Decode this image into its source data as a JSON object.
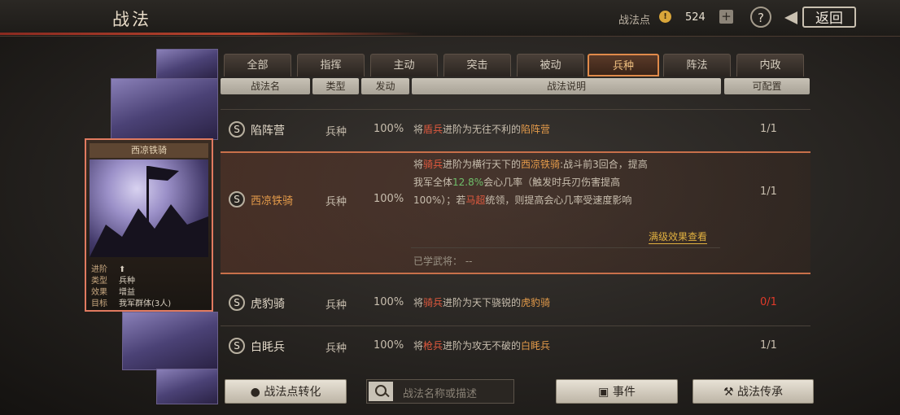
{
  "header": {
    "title": "战法",
    "points_label": "战法点",
    "points_icon_glyph": "!",
    "points_value": "524",
    "add_glyph": "+",
    "help_glyph": "?",
    "back_label": "返回"
  },
  "selected_card": {
    "name": "西凉铁骑",
    "rows": [
      {
        "k": "进阶",
        "v": "⬆"
      },
      {
        "k": "类型",
        "v": "兵种"
      },
      {
        "k": "效果",
        "v": "增益"
      },
      {
        "k": "目标",
        "v": "我军群体(3人)"
      }
    ]
  },
  "tabs": [
    {
      "label": "全部",
      "active": false
    },
    {
      "label": "指挥",
      "active": false
    },
    {
      "label": "主动",
      "active": false
    },
    {
      "label": "突击",
      "active": false
    },
    {
      "label": "被动",
      "active": false
    },
    {
      "label": "兵种",
      "active": true
    },
    {
      "label": "阵法",
      "active": false
    },
    {
      "label": "内政",
      "active": false
    }
  ],
  "columns": {
    "name": "战法名",
    "type": "类型",
    "rate": "发动",
    "desc": "战法说明",
    "cap": "可配置"
  },
  "rows": [
    {
      "grade": "S",
      "name": "陷阵营",
      "type": "兵种",
      "rate": "100%",
      "desc_parts": [
        {
          "t": "将",
          "c": ""
        },
        {
          "t": "盾兵",
          "c": "hl-red"
        },
        {
          "t": "进阶为无往不利的",
          "c": ""
        },
        {
          "t": "陷阵营",
          "c": "hl-orange"
        }
      ],
      "cap": "1/1"
    },
    {
      "grade": "S",
      "name": "西凉铁骑",
      "type": "兵种",
      "rate": "100%",
      "desc_lines": [
        [
          {
            "t": "将",
            "c": ""
          },
          {
            "t": "骑兵",
            "c": "hl-red"
          },
          {
            "t": "进阶为横行天下的",
            "c": ""
          },
          {
            "t": "西凉铁骑",
            "c": "hl-orange"
          },
          {
            "t": ":战斗前3回合，提高",
            "c": ""
          }
        ],
        [
          {
            "t": "我军全体",
            "c": ""
          },
          {
            "t": "12.8%",
            "c": "hl-green"
          },
          {
            "t": "会心几率（触发时兵刃伤害提高",
            "c": ""
          }
        ],
        [
          {
            "t": "100%）；若",
            "c": ""
          },
          {
            "t": "马超",
            "c": "hl-red"
          },
          {
            "t": "统领，则提高会心几率受速度影响",
            "c": ""
          }
        ]
      ],
      "link": "满级效果查看",
      "learned": "已学武将：  --",
      "cap": "1/1"
    },
    {
      "grade": "S",
      "name": "虎豹骑",
      "type": "兵种",
      "rate": "100%",
      "desc_parts": [
        {
          "t": "将",
          "c": ""
        },
        {
          "t": "骑兵",
          "c": "hl-red"
        },
        {
          "t": "进阶为天下骁锐的",
          "c": ""
        },
        {
          "t": "虎豹骑",
          "c": "hl-orange"
        }
      ],
      "cap": "0/1",
      "cap_red": true
    },
    {
      "grade": "S",
      "name": "白眊兵",
      "type": "兵种",
      "rate": "100%",
      "desc_parts": [
        {
          "t": "将",
          "c": ""
        },
        {
          "t": "枪兵",
          "c": "hl-red"
        },
        {
          "t": "进阶为攻无不破的",
          "c": ""
        },
        {
          "t": "白眊兵",
          "c": "hl-orange"
        }
      ],
      "cap": "1/1"
    }
  ],
  "bottom": {
    "convert_label": "战法点转化",
    "search_placeholder": "战法名称或描述",
    "event_label": "事件",
    "inherit_label": "战法传承"
  }
}
